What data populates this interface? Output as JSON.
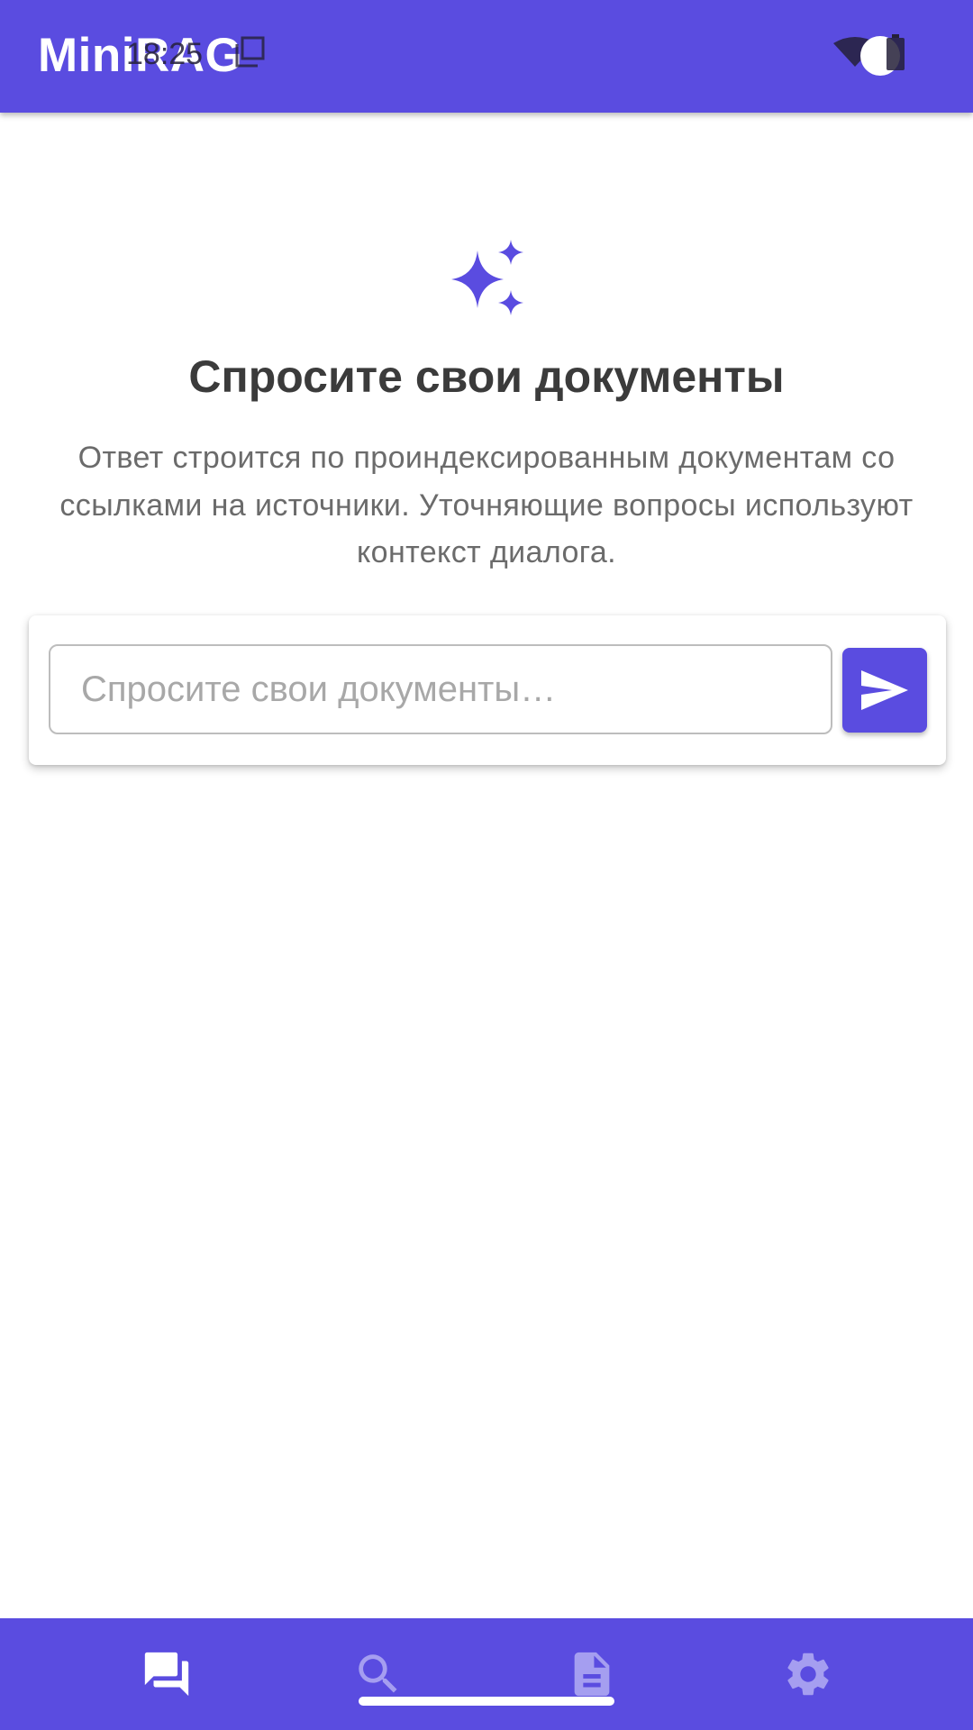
{
  "app_bar": {
    "title": "MiniRAG",
    "status_time": "18:25"
  },
  "empty_state": {
    "icon": "sparkles-icon",
    "title": "Спросите свои документы",
    "description": "Ответ строится по проиндексированным документам со ссылками на источники. Уточняющие вопросы используют контекст диалога."
  },
  "composer": {
    "placeholder": "Спросите свои документы…",
    "value": "",
    "send_icon": "send-icon"
  },
  "bottom_nav": {
    "items": [
      {
        "icon": "chat-icon",
        "active": true
      },
      {
        "icon": "search-icon",
        "active": false
      },
      {
        "icon": "document-icon",
        "active": false
      },
      {
        "icon": "settings-gear-icon",
        "active": false
      }
    ]
  },
  "colors": {
    "primary": "#5a4ce0",
    "nav_active": "#ffffff",
    "nav_inactive": "#a59ef0",
    "title_text": "#3b3b3b",
    "body_text": "#6b6b6b",
    "placeholder": "#a8a8a8"
  }
}
